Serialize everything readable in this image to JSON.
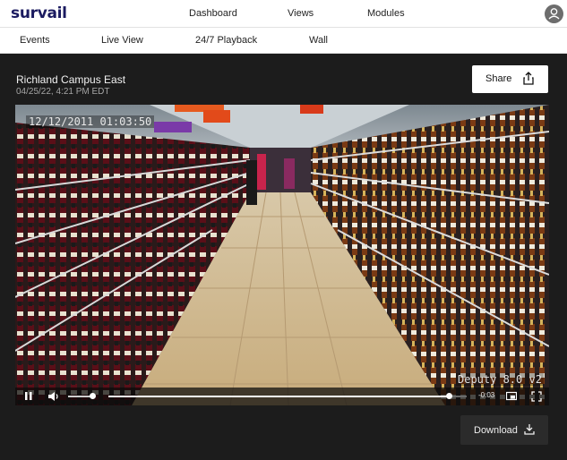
{
  "app": {
    "logo_text": "survail",
    "brand_color": "#1b1b60"
  },
  "top_nav": {
    "items": [
      {
        "label": "Dashboard"
      },
      {
        "label": "Views"
      },
      {
        "label": "Modules"
      }
    ],
    "avatar_icon": "user-icon"
  },
  "sub_nav": {
    "items": [
      {
        "label": "Events"
      },
      {
        "label": "Live View"
      },
      {
        "label": "24/7 Playback"
      },
      {
        "label": "Wall"
      }
    ]
  },
  "camera": {
    "title": "Richland Campus East",
    "timestamp": "04/25/22, 4:21 PM EDT"
  },
  "share": {
    "label": "Share",
    "icon": "share-icon"
  },
  "video": {
    "osd_timestamp": "12/12/2011 01:03:50",
    "osd_version": "Deputy 8.0 v2",
    "scene": "supermarket wine aisle"
  },
  "player": {
    "play_state_icon": "pause-icon",
    "volume_icon": "volume-icon",
    "volume_level": 0.9,
    "progress": 0.95,
    "remaining": "-0:03",
    "pip_icon": "picture-in-picture-icon",
    "fullscreen_icon": "fullscreen-icon"
  },
  "download": {
    "label": "Download",
    "icon": "download-icon"
  },
  "colors": {
    "panel_bg": "#1c1c1c",
    "controls_bg": "#0a0a0a"
  }
}
